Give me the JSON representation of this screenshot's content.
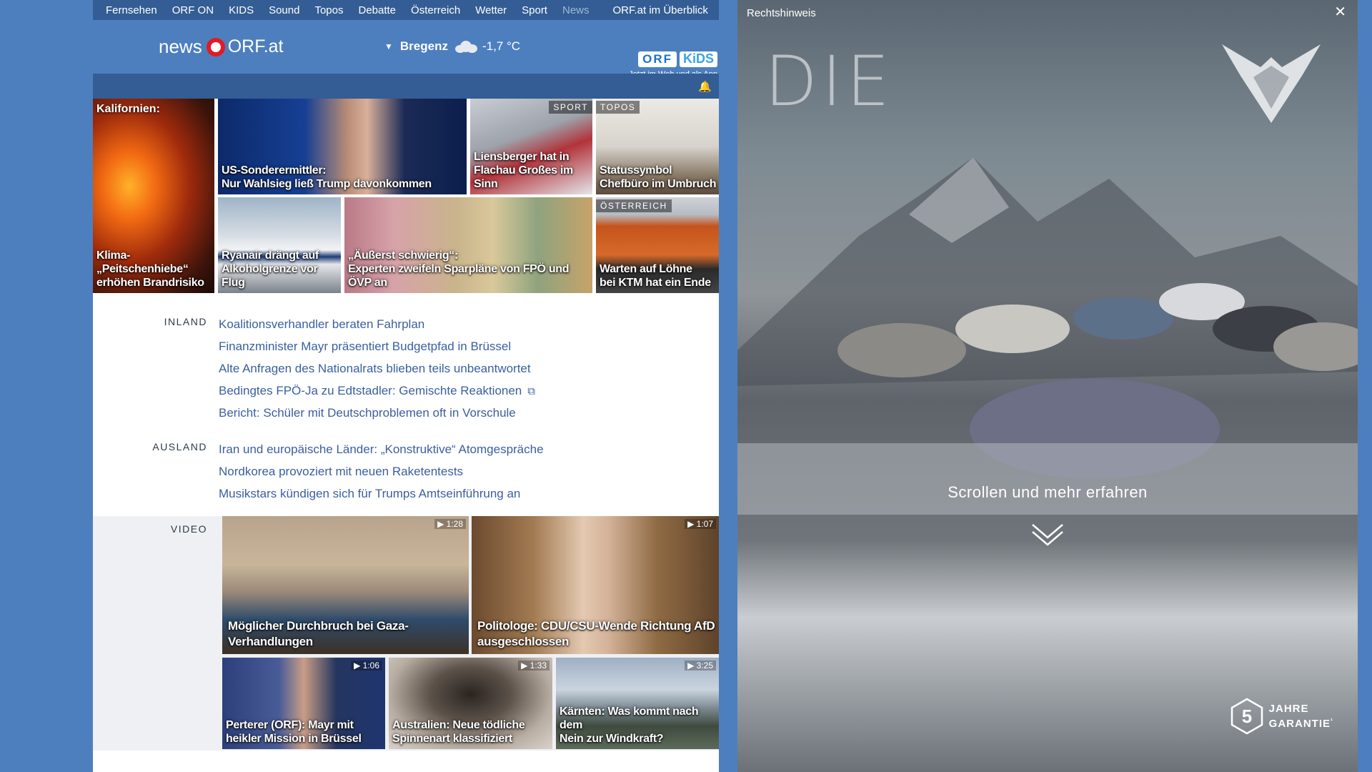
{
  "nav": {
    "items": [
      "Fernsehen",
      "ORF ON",
      "KIDS",
      "Sound",
      "Topos",
      "Debatte",
      "Österreich",
      "Wetter",
      "Sport",
      "News"
    ],
    "active": "News",
    "overview": "ORF.at im Überblick"
  },
  "header": {
    "logo_news": "news",
    "logo_site": "ORF.at",
    "weather_location": "Bregenz",
    "weather_temp": "-1,7 °C",
    "promo_orf": "ORF",
    "promo_kids": "KiDS",
    "promo_sub": "Jetzt im Web und als App"
  },
  "top_stories": [
    {
      "pretitle": "Kalifornien:",
      "title_1": "Klima-„Peitschenhiebe“",
      "title_2": "erhöhen Brandrisiko"
    },
    {
      "title_1": "US-Sonderermittler:",
      "title_2": "Nur Wahlsieg ließ Trump davonkommen"
    },
    {
      "tag": "SPORT",
      "title_1": "Liensberger hat in",
      "title_2": "Flachau Großes im Sinn"
    },
    {
      "tag": "TOPOS",
      "title_1": "Statussymbol",
      "title_2": "Chefbüro im Umbruch"
    },
    {
      "title_1": "Ryanair drängt auf",
      "title_2": "Alkoholgrenze vor Flug"
    },
    {
      "title_1": "„Äußerst schwierig“:",
      "title_2": "Experten zweifeln Sparpläne von FPÖ und ÖVP an"
    },
    {
      "tag": "ÖSTERREICH",
      "title_1": "Warten auf Löhne",
      "title_2": "bei KTM hat ein Ende"
    }
  ],
  "inland": {
    "label": "INLAND",
    "items": [
      "Koalitionsverhandler beraten Fahrplan",
      "Finanzminister Mayr präsentiert Budgetpfad in Brüssel",
      "Alte Anfragen des Nationalrats blieben teils unbeantwortet",
      "Bedingtes FPÖ-Ja zu Edtstadler: Gemischte Reaktionen",
      "Bericht: Schüler mit Deutschproblemen oft in Vorschule"
    ]
  },
  "ausland": {
    "label": "AUSLAND",
    "items": [
      "Iran und europäische Länder: „Konstruktive“ Atomgespräche",
      "Nordkorea provoziert mit neuen Raketentests",
      "Musikstars kündigen sich für Trumps Amtseinführung an"
    ]
  },
  "video": {
    "label": "VIDEO",
    "items": [
      {
        "duration": "1:28",
        "title_1": "Möglicher Durchbruch bei Gaza-",
        "title_2": "Verhandlungen"
      },
      {
        "duration": "1:07",
        "title_1": "Politologe: CDU/CSU-Wende Richtung AfD",
        "title_2": "ausgeschlossen"
      },
      {
        "duration": "1:06",
        "title_1": "Perterer (ORF): Mayr mit",
        "title_2": "heikler Mission in Brüssel"
      },
      {
        "duration": "1:33",
        "title_1": "Australien: Neue tödliche",
        "title_2": "Spinnenart klassifiziert"
      },
      {
        "duration": "3:25",
        "title_1": "Kärnten: Was kommt nach dem",
        "title_2": "Nein zur Windkraft?"
      }
    ]
  },
  "ad": {
    "legal": "Rechtshinweis",
    "headline": "DIE",
    "scroll_text": "Scrollen und mehr erfahren",
    "guarantee_number": "5",
    "guarantee_line1": "JAHRE",
    "guarantee_line2": "GARANTIE",
    "guarantee_sup": "¹"
  }
}
